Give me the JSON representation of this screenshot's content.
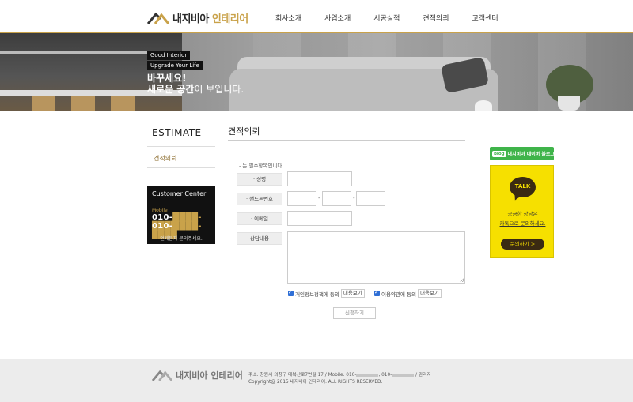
{
  "brand": {
    "logo_main": "내지비아",
    "logo_accent": "인테리어"
  },
  "nav": [
    "회사소개",
    "사업소개",
    "시공실적",
    "견적의뢰",
    "고객센터"
  ],
  "hero": {
    "badge1": "Good Interior",
    "badge2": "Upgrade Your Life",
    "line1": "바꾸세요!",
    "line2_bold": "새로운 공간",
    "line2_rest": "이 보입니다."
  },
  "sidebar": {
    "title": "ESTIMATE",
    "item": "견적의뢰",
    "customer_center": {
      "title": "Customer Center",
      "mobile_label": "Mobile",
      "num1_prefix": "010-",
      "num1_mask": "████-████",
      "num2_prefix": "010-",
      "num2_mask": "████-████",
      "note": "언제든지 문의주세요."
    }
  },
  "form": {
    "title": "견적의뢰",
    "required_note": "- 는 필수항목입니다.",
    "labels": {
      "name": "· 성명",
      "phone": "· 핸드폰번호",
      "email": "· 이메일",
      "content": "상담내용"
    },
    "agree1": "개인정보정책에 동의",
    "agree2": "이용약관에 동의",
    "view": "내용보기",
    "submit": "신청하기"
  },
  "right": {
    "blog_tag": "blog",
    "blog_text": "내지비아 네이버 블로그",
    "talk_label": "TALK",
    "talk_q1": "궁금한 상담은",
    "talk_q2": "카톡으로 문의하세요.",
    "talk_button": "문의하기 >"
  },
  "footer": {
    "logo_main": "내지비아",
    "logo_accent": "인테리어",
    "address_prefix": "주소. 창원시 의창구 태복산로7번길 17  /  Mobile. 010-",
    "address_mid": ", 010-",
    "address_suffix": "  /  관리자",
    "copyright": "Copyright@ 2015 내지비아 인테리어. ALL RIGHTS RESERVED."
  },
  "colors": {
    "gold": "#c9a24a",
    "kakao": "#f6e000",
    "naver": "#3fb44a"
  }
}
